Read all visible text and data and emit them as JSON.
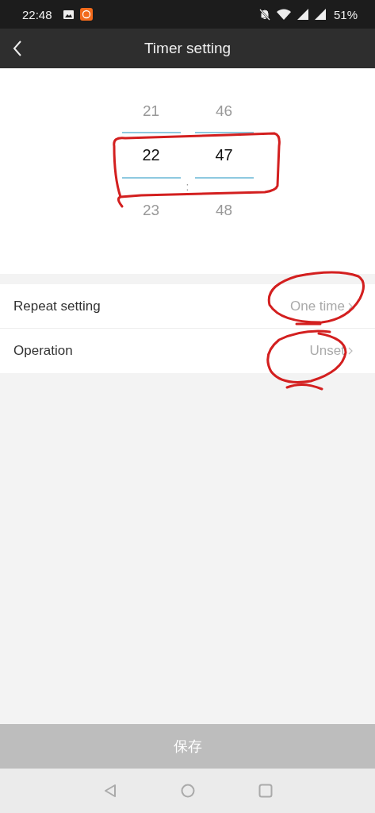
{
  "status_bar": {
    "time": "22:48",
    "battery": "51%"
  },
  "header": {
    "title": "Timer setting"
  },
  "picker": {
    "separator": ":",
    "columns": [
      {
        "above": "21",
        "value": "22",
        "below": "23"
      },
      {
        "above": "46",
        "value": "47",
        "below": "48"
      }
    ]
  },
  "settings": [
    {
      "label": "Repeat setting",
      "value": "One time"
    },
    {
      "label": "Operation",
      "value": "Unset"
    }
  ],
  "save_button": {
    "label": "保存",
    "disabled": true
  }
}
